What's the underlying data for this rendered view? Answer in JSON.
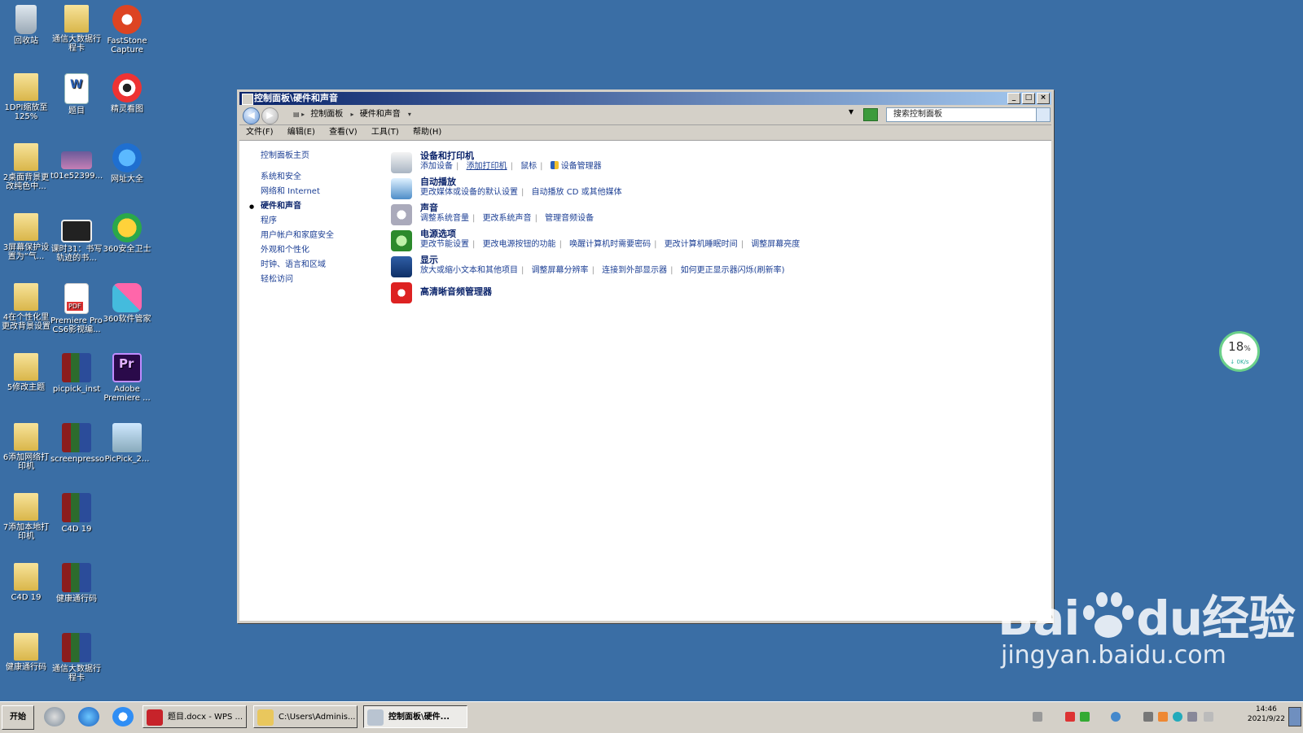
{
  "desktop": {
    "icons": [
      {
        "label": "回收站",
        "icon": "recycle-bin-icon"
      },
      {
        "label": "通信大数据行程卡",
        "icon": "folder-icon"
      },
      {
        "label": "FastStone Capture",
        "icon": "faststone-icon"
      },
      {
        "label": "1DPI缩放至125%",
        "icon": "folder-icon"
      },
      {
        "label": "题目",
        "icon": "word-doc-icon"
      },
      {
        "label": "精灵看图",
        "icon": "image-viewer-icon"
      },
      {
        "label": "2桌面背景更改纯色中...",
        "icon": "folder-icon"
      },
      {
        "label": "t01e52399...",
        "icon": "image-file-icon"
      },
      {
        "label": "网址大全",
        "icon": "ie-icon"
      },
      {
        "label": "3屏幕保护设置为“气...",
        "icon": "folder-icon"
      },
      {
        "label": "课时31：书写轨迹的书...",
        "icon": "video-file-icon"
      },
      {
        "label": "360安全卫士",
        "icon": "360-safe-icon"
      },
      {
        "label": "4在个性化里更改背景设置",
        "icon": "folder-icon"
      },
      {
        "label": "Premiere Pro CS6影视编...",
        "icon": "pdf-icon"
      },
      {
        "label": "360软件管家",
        "icon": "360-apps-icon"
      },
      {
        "label": "5修改主题",
        "icon": "folder-icon"
      },
      {
        "label": "picpick_inst",
        "icon": "winrar-icon"
      },
      {
        "label": "Adobe Premiere ...",
        "icon": "premiere-icon"
      },
      {
        "label": "6添加网络打印机",
        "icon": "folder-icon"
      },
      {
        "label": "screenpresso",
        "icon": "winrar-icon"
      },
      {
        "label": "PicPick_2...",
        "icon": "picpick-icon"
      },
      {
        "label": "7添加本地打印机",
        "icon": "folder-icon"
      },
      {
        "label": "C4D 19",
        "icon": "winrar-icon"
      },
      {
        "label": "C4D 19",
        "icon": "folder-icon"
      },
      {
        "label": "健康通行码",
        "icon": "winrar-icon"
      },
      {
        "label": "健康通行码",
        "icon": "folder-icon"
      },
      {
        "label": "通信大数据行程卡",
        "icon": "winrar-icon"
      }
    ]
  },
  "window": {
    "title": "控制面板\\硬件和声音",
    "address": {
      "crumbs": [
        "控制面板",
        "硬件和声音"
      ]
    },
    "search": {
      "placeholder": "搜索控制面板"
    },
    "menu": [
      "文件(F)",
      "编辑(E)",
      "查看(V)",
      "工具(T)",
      "帮助(H)"
    ],
    "leftnav": {
      "home": "控制面板主页",
      "items": [
        "系统和安全",
        "网络和 Internet",
        "硬件和声音",
        "程序",
        "用户帐户和家庭安全",
        "外观和个性化",
        "时钟、语言和区域",
        "轻松访问"
      ],
      "current_index": 2
    },
    "categories": [
      {
        "title": "设备和打印机",
        "icon": "printer-icon",
        "links": [
          "添加设备",
          "添加打印机",
          "鼠标",
          "设备管理器"
        ]
      },
      {
        "title": "自动播放",
        "icon": "autoplay-icon",
        "links": [
          "更改媒体或设备的默认设置",
          "自动播放 CD 或其他媒体"
        ]
      },
      {
        "title": "声音",
        "icon": "speaker-icon",
        "links": [
          "调整系统音量",
          "更改系统声音",
          "管理音频设备"
        ]
      },
      {
        "title": "电源选项",
        "icon": "power-icon",
        "links": [
          "更改节能设置",
          "更改电源按钮的功能",
          "唤醒计算机时需要密码",
          "更改计算机睡眠时间",
          "调整屏幕亮度"
        ]
      },
      {
        "title": "显示",
        "icon": "display-icon",
        "links": [
          "放大或缩小文本和其他项目",
          "调整屏幕分辨率",
          "连接到外部显示器",
          "如何更正显示器闪烁(刷新率)"
        ]
      },
      {
        "title": "高清晰音频管理器",
        "icon": "audio-manager-icon",
        "links": []
      }
    ]
  },
  "netwidget": {
    "percent": "18",
    "unit": "%",
    "speed": "↓ 0K/s"
  },
  "watermark": {
    "logo": "Bai",
    "logo_tail": "du经验",
    "url": "jingyan.baidu.com"
  },
  "taskbar": {
    "start": "开始",
    "tasks": [
      {
        "label": "题目.docx - WPS ..."
      },
      {
        "label": "C:\\Users\\Adminis..."
      },
      {
        "label": "控制面板\\硬件..."
      }
    ],
    "clock": {
      "time": "14:46",
      "date": "2021/9/22"
    }
  },
  "colors": {
    "desktop": "#3a6ea5",
    "titlebar": "#0a246a",
    "link": "#1c3f94"
  }
}
